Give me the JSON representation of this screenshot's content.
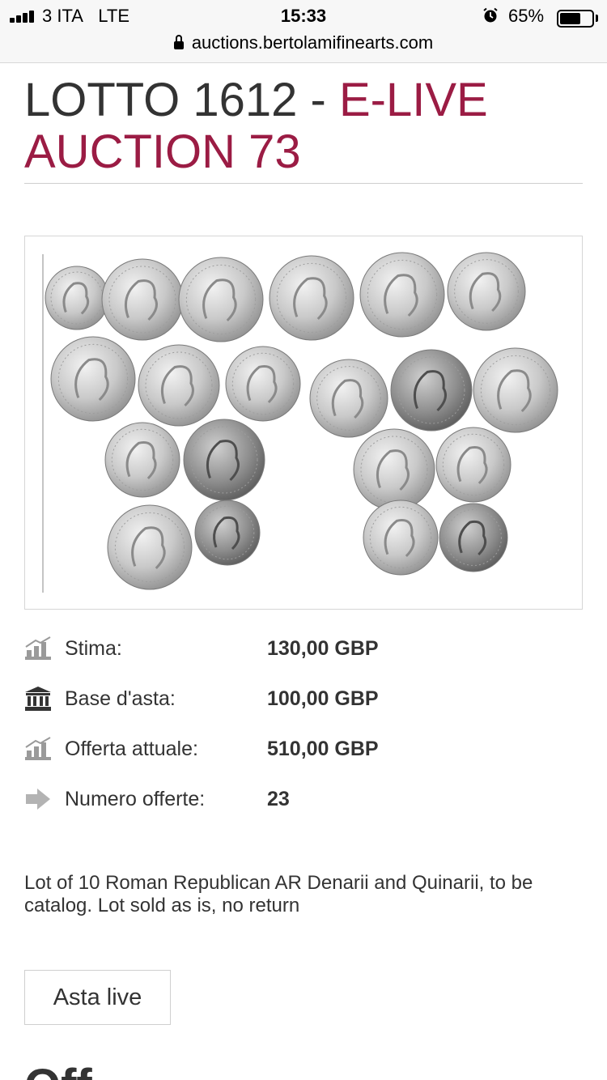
{
  "status_bar": {
    "carrier": "3 ITA",
    "network": "LTE",
    "time": "15:33",
    "battery_percent": "65%",
    "battery_level": 0.65,
    "url": "auctions.bertolamifinearts.com"
  },
  "title": {
    "prefix": "LOTTO 1612 - ",
    "auction": "E-LIVE AUCTION 73"
  },
  "image": {
    "alt": "Lot of Roman Republican silver coins"
  },
  "details": [
    {
      "icon": "chart-icon",
      "label": "Stima:",
      "value": "130,00 GBP"
    },
    {
      "icon": "bank-icon",
      "label": "Base d'asta:",
      "value": "100,00 GBP"
    },
    {
      "icon": "chart-icon",
      "label": "Offerta attuale:",
      "value": "510,00 GBP"
    },
    {
      "icon": "arrow-right-icon",
      "label": "Numero offerte:",
      "value": "23"
    }
  ],
  "description": "Lot of 10 Roman Republican AR Denarii and Quinarii, to be catalog. Lot sold as is, no return",
  "live_button": "Asta live",
  "next_heading": "Off",
  "colors": {
    "accent": "#9b1c44",
    "text": "#333333",
    "icon_gray": "#9a9a9a"
  }
}
